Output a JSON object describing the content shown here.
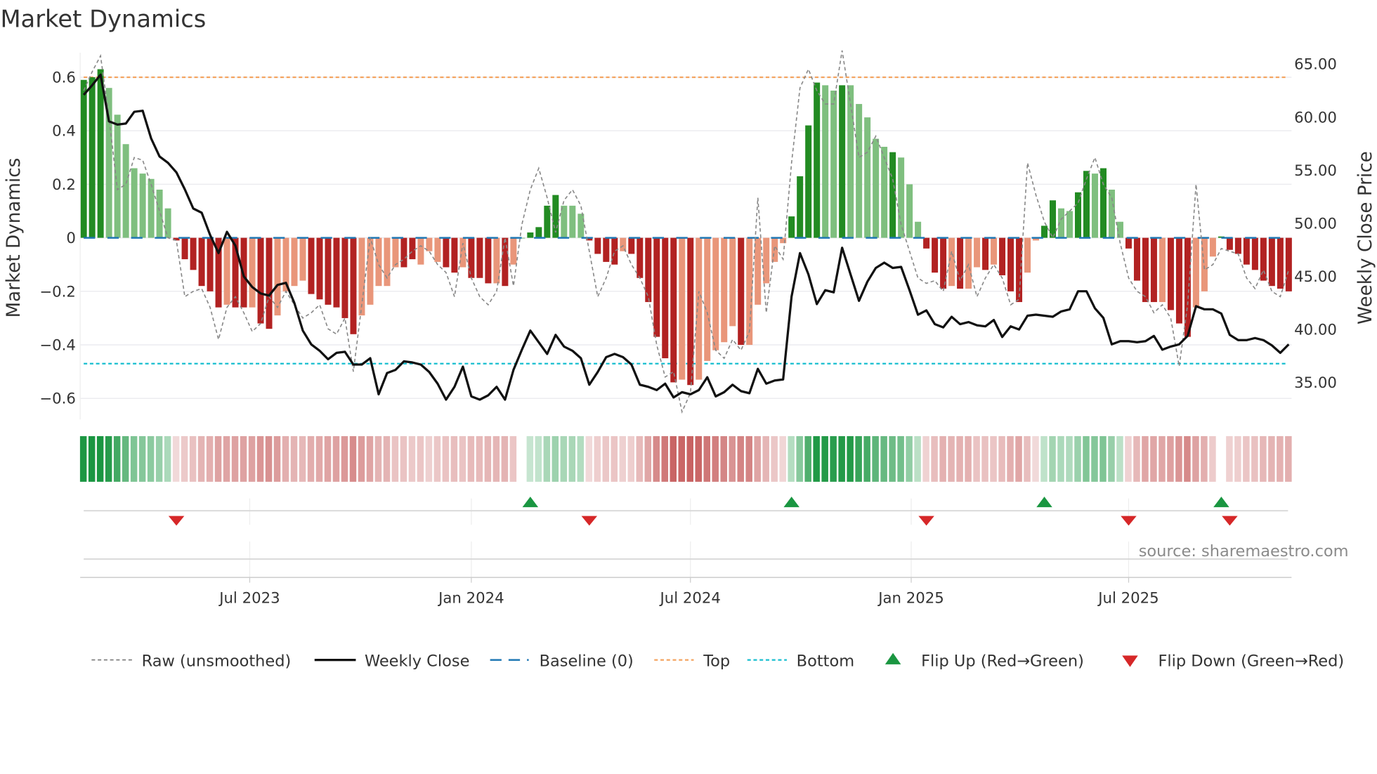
{
  "chart_data": {
    "type": "bar",
    "title": "Market Dynamics",
    "ylabel": "Market Dynamics",
    "y2label": "Weekly Close Price",
    "ylim": [
      -0.68,
      0.68
    ],
    "y2lim": [
      31.5,
      66.3
    ],
    "yticks": [
      -0.6,
      -0.4,
      -0.2,
      0,
      0.2,
      0.4,
      0.6
    ],
    "yticklabels": [
      "−0.6",
      "−0.4",
      "−0.2",
      "0",
      "0.2",
      "0.4",
      "0.6"
    ],
    "y2ticks": [
      35,
      40,
      45,
      50,
      55,
      60,
      65
    ],
    "y2ticklabels": [
      "35.00",
      "40.00",
      "45.00",
      "50.00",
      "55.00",
      "60.00",
      "65.00"
    ],
    "xticks": [
      {
        "week": 19.7,
        "label": "Jul 2023"
      },
      {
        "week": 46.0,
        "label": "Jan 2024"
      },
      {
        "week": 72.0,
        "label": "Jul 2024"
      },
      {
        "week": 98.2,
        "label": "Jan 2025"
      },
      {
        "week": 124.0,
        "label": "Jul 2025"
      }
    ],
    "top_level": 0.6,
    "bottom_level": -0.47,
    "baseline": 0,
    "values": [
      0.59,
      0.6,
      0.63,
      0.56,
      0.46,
      0.35,
      0.26,
      0.24,
      0.22,
      0.18,
      0.11,
      -0.01,
      -0.08,
      -0.12,
      -0.18,
      -0.2,
      -0.26,
      -0.25,
      -0.26,
      -0.26,
      -0.26,
      -0.32,
      -0.34,
      -0.29,
      -0.2,
      -0.18,
      -0.16,
      -0.21,
      -0.23,
      -0.25,
      -0.26,
      -0.3,
      -0.36,
      -0.29,
      -0.25,
      -0.18,
      -0.18,
      -0.11,
      -0.11,
      -0.08,
      -0.1,
      -0.05,
      -0.09,
      -0.11,
      -0.13,
      -0.11,
      -0.15,
      -0.15,
      -0.17,
      -0.17,
      -0.18,
      -0.1,
      0.0,
      0.02,
      0.04,
      0.12,
      0.16,
      0.12,
      0.12,
      0.09,
      -0.01,
      -0.06,
      -0.09,
      -0.1,
      -0.05,
      -0.06,
      -0.15,
      -0.24,
      -0.37,
      -0.45,
      -0.54,
      -0.53,
      -0.55,
      -0.53,
      -0.46,
      -0.42,
      -0.39,
      -0.33,
      -0.4,
      -0.4,
      -0.25,
      -0.17,
      -0.09,
      -0.02,
      0.08,
      0.23,
      0.42,
      0.58,
      0.57,
      0.55,
      0.57,
      0.57,
      0.5,
      0.45,
      0.37,
      0.34,
      0.32,
      0.3,
      0.2,
      0.06,
      -0.04,
      -0.13,
      -0.19,
      -0.18,
      -0.19,
      -0.19,
      -0.11,
      -0.12,
      -0.1,
      -0.14,
      -0.2,
      -0.24,
      -0.13,
      -0.01,
      0.045,
      0.14,
      0.11,
      0.1,
      0.17,
      0.25,
      0.24,
      0.26,
      0.18,
      0.06,
      -0.04,
      -0.16,
      -0.24,
      -0.24,
      -0.24,
      -0.27,
      -0.32,
      -0.37,
      -0.26,
      -0.2,
      -0.07,
      0.005,
      -0.045,
      -0.06,
      -0.1,
      -0.12,
      -0.16,
      -0.18,
      -0.19,
      -0.2
    ],
    "strong": [
      1,
      1,
      1,
      0,
      0,
      0,
      0,
      0,
      0,
      0,
      0,
      1,
      1,
      1,
      1,
      1,
      1,
      0,
      1,
      1,
      0,
      1,
      1,
      0,
      0,
      0,
      0,
      1,
      1,
      1,
      1,
      1,
      1,
      0,
      0,
      0,
      0,
      0,
      1,
      1,
      0,
      0,
      0,
      1,
      1,
      0,
      1,
      1,
      1,
      0,
      1,
      0,
      0,
      1,
      1,
      1,
      1,
      0,
      0,
      0,
      1,
      1,
      1,
      1,
      0,
      1,
      1,
      1,
      1,
      1,
      1,
      0,
      1,
      0,
      0,
      0,
      0,
      0,
      1,
      0,
      0,
      0,
      0,
      0,
      1,
      1,
      1,
      1,
      0,
      0,
      1,
      0,
      0,
      0,
      0,
      0,
      1,
      0,
      0,
      0,
      1,
      1,
      1,
      0,
      1,
      0,
      0,
      1,
      0,
      1,
      1,
      1,
      0,
      0,
      1,
      1,
      0,
      0,
      1,
      1,
      0,
      1,
      0,
      0,
      1,
      1,
      1,
      1,
      0,
      1,
      1,
      1,
      0,
      0,
      0,
      1,
      1,
      1,
      1,
      1,
      1,
      1,
      1,
      1
    ],
    "raw": [
      0.55,
      0.62,
      0.68,
      0.45,
      0.18,
      0.2,
      0.3,
      0.29,
      0.2,
      0.1,
      0.0,
      -0.01,
      -0.22,
      -0.2,
      -0.19,
      -0.26,
      -0.38,
      -0.26,
      -0.22,
      -0.28,
      -0.35,
      -0.32,
      -0.22,
      -0.26,
      -0.2,
      -0.25,
      -0.3,
      -0.28,
      -0.25,
      -0.34,
      -0.36,
      -0.3,
      -0.5,
      -0.25,
      0.0,
      -0.1,
      -0.15,
      -0.1,
      -0.08,
      -0.05,
      -0.03,
      -0.05,
      -0.1,
      -0.13,
      -0.22,
      -0.02,
      -0.15,
      -0.22,
      -0.25,
      -0.2,
      0.0,
      -0.18,
      0.05,
      0.18,
      0.26,
      0.15,
      0.02,
      0.14,
      0.18,
      0.12,
      -0.05,
      -0.22,
      -0.15,
      -0.05,
      -0.03,
      -0.1,
      -0.15,
      -0.22,
      -0.4,
      -0.52,
      -0.5,
      -0.65,
      -0.58,
      -0.2,
      -0.28,
      -0.42,
      -0.45,
      -0.38,
      -0.42,
      -0.35,
      0.15,
      -0.28,
      -0.03,
      -0.08,
      0.28,
      0.56,
      0.63,
      0.55,
      0.5,
      0.5,
      0.7,
      0.5,
      0.3,
      0.32,
      0.38,
      0.3,
      0.22,
      0.05,
      -0.05,
      -0.15,
      -0.17,
      -0.16,
      -0.2,
      -0.05,
      -0.16,
      -0.1,
      -0.22,
      -0.15,
      -0.1,
      -0.15,
      -0.25,
      -0.23,
      0.28,
      0.16,
      0.06,
      0.0,
      0.07,
      0.1,
      0.13,
      0.22,
      0.3,
      0.2,
      0.15,
      -0.02,
      -0.15,
      -0.2,
      -0.22,
      -0.28,
      -0.25,
      -0.3,
      -0.48,
      -0.25,
      0.2,
      -0.12,
      -0.1,
      -0.04,
      -0.05,
      -0.06,
      -0.15,
      -0.19,
      -0.12,
      -0.2,
      -0.22,
      -0.12
    ],
    "close": [
      62.1,
      63.0,
      64.0,
      59.6,
      59.3,
      59.4,
      60.5,
      60.6,
      58.0,
      56.3,
      55.7,
      54.8,
      53.2,
      51.4,
      51.0,
      48.9,
      47.2,
      49.2,
      47.9,
      45.0,
      44.0,
      43.4,
      43.2,
      44.2,
      44.4,
      42.5,
      39.9,
      38.6,
      38.0,
      37.2,
      37.8,
      37.9,
      36.7,
      36.7,
      37.3,
      33.9,
      35.9,
      36.2,
      37.0,
      36.9,
      36.7,
      36.0,
      34.9,
      33.4,
      34.6,
      36.5,
      33.7,
      33.4,
      33.8,
      34.6,
      33.4,
      36.2,
      38.1,
      39.9,
      38.8,
      37.7,
      39.5,
      38.4,
      38.0,
      37.3,
      34.8,
      36.0,
      37.4,
      37.7,
      37.4,
      36.7,
      34.8,
      34.6,
      34.3,
      34.9,
      33.6,
      34.1,
      33.9,
      34.3,
      35.5,
      33.7,
      34.1,
      34.8,
      34.2,
      34.0,
      36.3,
      34.9,
      35.2,
      35.3,
      43.1,
      47.2,
      45.2,
      42.4,
      43.7,
      43.5,
      47.7,
      45.2,
      42.7,
      44.5,
      45.8,
      46.3,
      45.8,
      45.9,
      43.7,
      41.4,
      41.8,
      40.5,
      40.2,
      41.2,
      40.5,
      40.7,
      40.4,
      40.3,
      40.9,
      39.3,
      40.3,
      40.0,
      41.3,
      41.4,
      41.3,
      41.2,
      41.7,
      41.9,
      43.6,
      43.6,
      42.0,
      41.1,
      38.6,
      38.9,
      38.9,
      38.8,
      38.9,
      39.4,
      38.1,
      38.4,
      38.6,
      39.4,
      42.2,
      41.9,
      41.9,
      41.5,
      39.5,
      39.0,
      39.0,
      39.2,
      39.0,
      38.5,
      37.8,
      38.6
    ],
    "flips_up_week": [
      53,
      84,
      114,
      135
    ],
    "flips_down_week": [
      11,
      60,
      100,
      124,
      136
    ],
    "colors": {
      "green_strong": "#228b22",
      "green_weak": "#7fbf7f",
      "red_strong": "#b22222",
      "red_weak": "#e9967a",
      "baseline": "#1f77b4",
      "top": "#f4a460",
      "bottom": "#17becf",
      "flip_up": "#1a9641",
      "flip_down": "#d62728"
    },
    "legend": {
      "position": "bottom",
      "items": [
        "Raw (unsmoothed)",
        "Weekly Close",
        "Baseline (0)",
        "Top",
        "Bottom",
        "Flip Up (Red→Green)",
        "Flip Down (Green→Red)"
      ]
    },
    "annotation": "source: sharemaestro.com"
  }
}
